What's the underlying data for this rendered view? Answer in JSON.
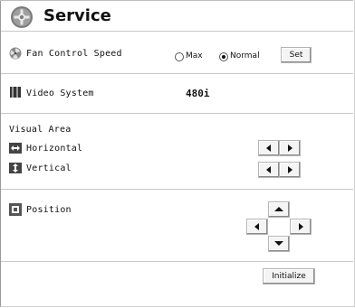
{
  "title": "Service",
  "fan": {
    "label": "Fan Control Speed",
    "options": [
      "Max",
      "Normal"
    ],
    "selected": "Normal",
    "set_label": "Set"
  },
  "video": {
    "label": "Video System",
    "value": "480i"
  },
  "visual_area": {
    "heading": "Visual Area",
    "horizontal_label": "Horizontal",
    "vertical_label": "Vertical"
  },
  "position": {
    "label": "Position"
  },
  "initialize_label": "Initialize",
  "icons": {
    "title": "gear-icon",
    "fan": "fan-icon",
    "video": "video-system-icon",
    "horizontal": "horizontal-arrows-icon",
    "vertical": "vertical-arrows-icon",
    "position": "position-icon"
  },
  "colors": {
    "background": "#ffffff",
    "text": "#111111",
    "separator": "#c8c8c8",
    "button_face": "#f4f4f4"
  }
}
